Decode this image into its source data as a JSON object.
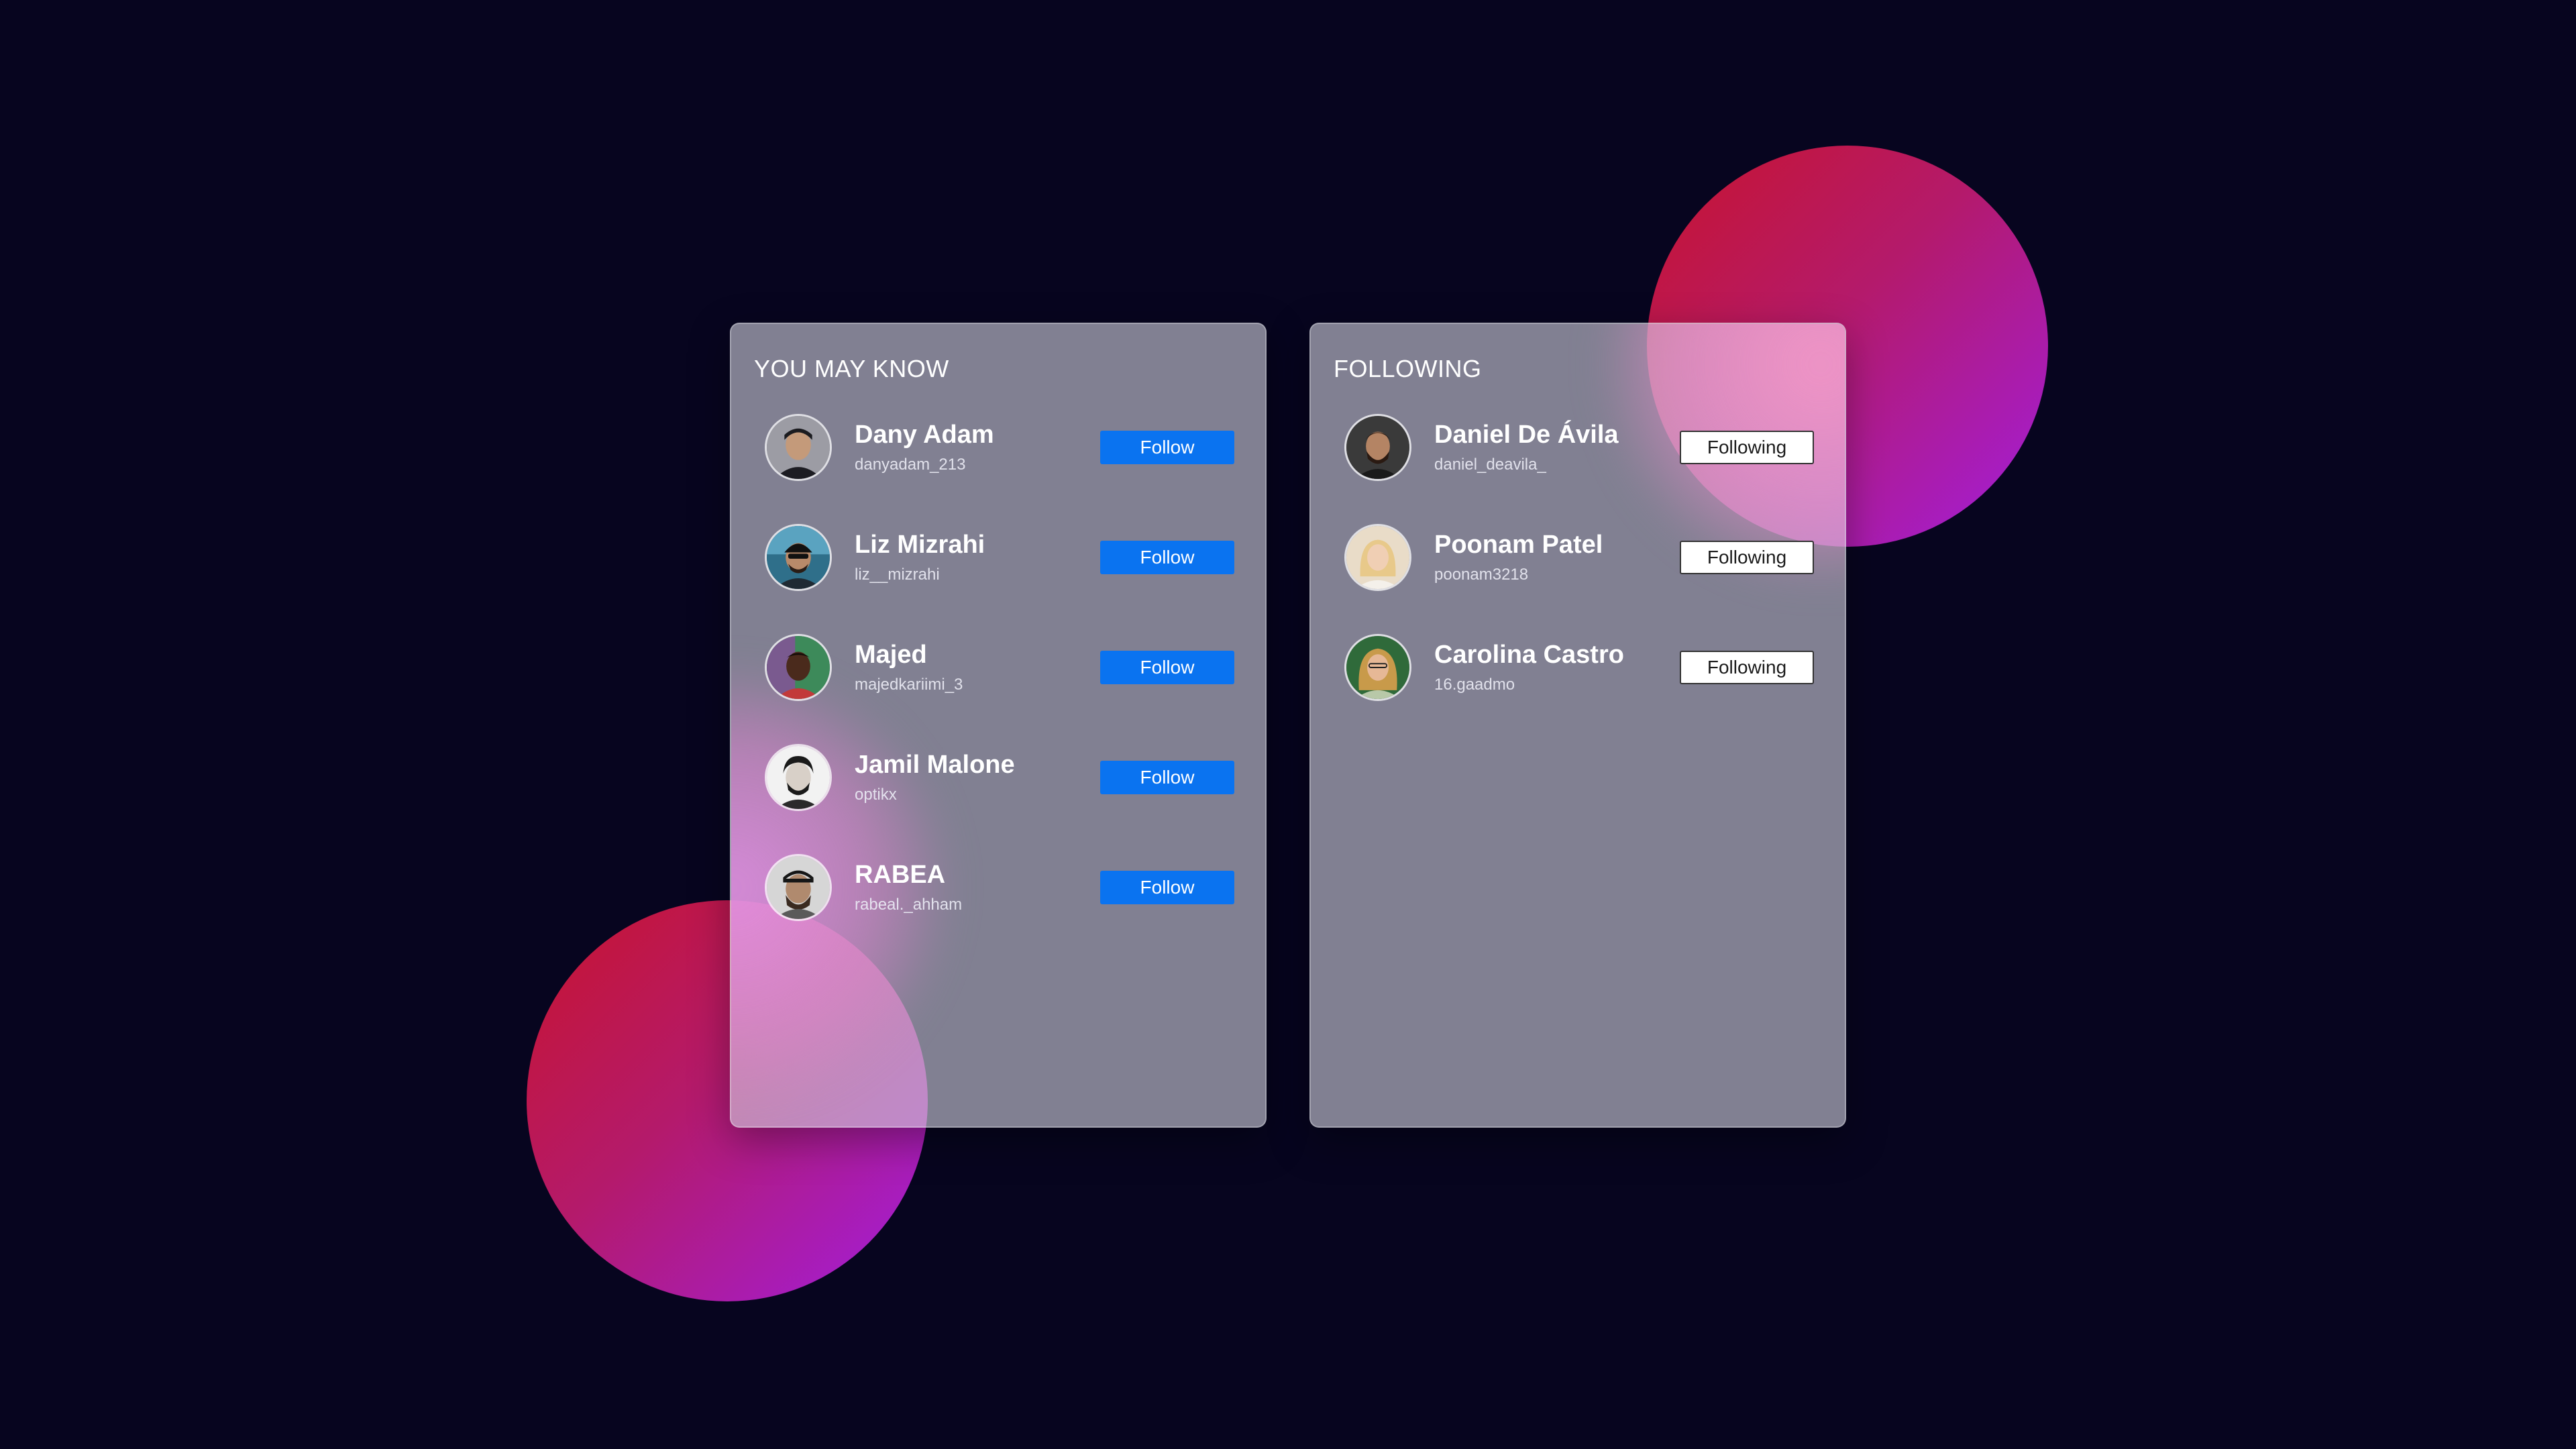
{
  "you_may_know": {
    "title": "YOU MAY KNOW",
    "button_label": "Follow",
    "people": [
      {
        "name": "Dany Adam",
        "handle": "danyadam_213"
      },
      {
        "name": "Liz Mizrahi",
        "handle": "liz__mizrahi"
      },
      {
        "name": "Majed",
        "handle": "majedkariimi_3"
      },
      {
        "name": "Jamil Malone",
        "handle": "optikx"
      },
      {
        "name": "RABEA",
        "handle": "rabeal._ahham"
      }
    ]
  },
  "following": {
    "title": "FOLLOWING",
    "button_label": "Following",
    "people": [
      {
        "name": "Daniel De Ávila",
        "handle": "daniel_deavila_"
      },
      {
        "name": "Poonam Patel",
        "handle": "poonam3218"
      },
      {
        "name": "Carolina Castro",
        "handle": "16.gaadmo"
      }
    ]
  },
  "colors": {
    "background": "#07051f",
    "follow_button": "#0a73f0",
    "blob_start": "#c8142d",
    "blob_end": "#a21ee0"
  }
}
